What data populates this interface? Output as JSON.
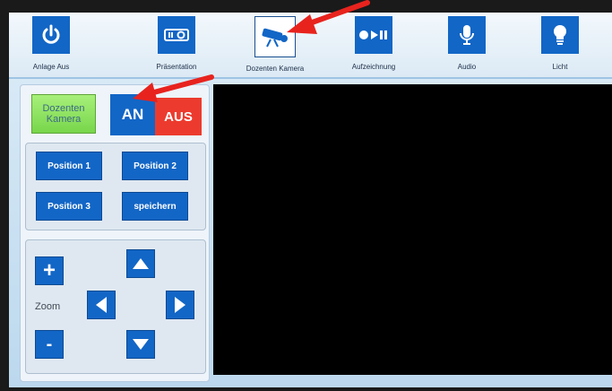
{
  "topbar": {
    "items": [
      {
        "label": "Anlage Aus",
        "icon": "power-icon"
      },
      {
        "label": "Präsentation",
        "icon": "projector-icon"
      },
      {
        "label": "Dozenten Kamera",
        "icon": "camera-icon",
        "active": true
      },
      {
        "label": "Aufzeichnung",
        "icon": "record-play-pause-icon"
      },
      {
        "label": "Audio",
        "icon": "microphone-icon"
      },
      {
        "label": "Licht",
        "icon": "lightbulb-icon"
      }
    ]
  },
  "camera_panel": {
    "status_label": "Dozenten Kamera",
    "on_label": "AN",
    "off_label": "AUS"
  },
  "positions": {
    "pos1": "Position 1",
    "pos2": "Position 2",
    "pos3": "Position 3",
    "save": "speichern"
  },
  "ptz": {
    "zoom_label": "Zoom",
    "zoom_in": "+",
    "zoom_out": "-",
    "icons": [
      "arrow-up-icon",
      "arrow-left-icon",
      "arrow-right-icon",
      "arrow-down-icon"
    ]
  },
  "colors": {
    "accent_blue": "#1266c6",
    "on_green": "#78d64b",
    "off_red": "#ec3b2e",
    "annotation_red": "#e8231e"
  }
}
